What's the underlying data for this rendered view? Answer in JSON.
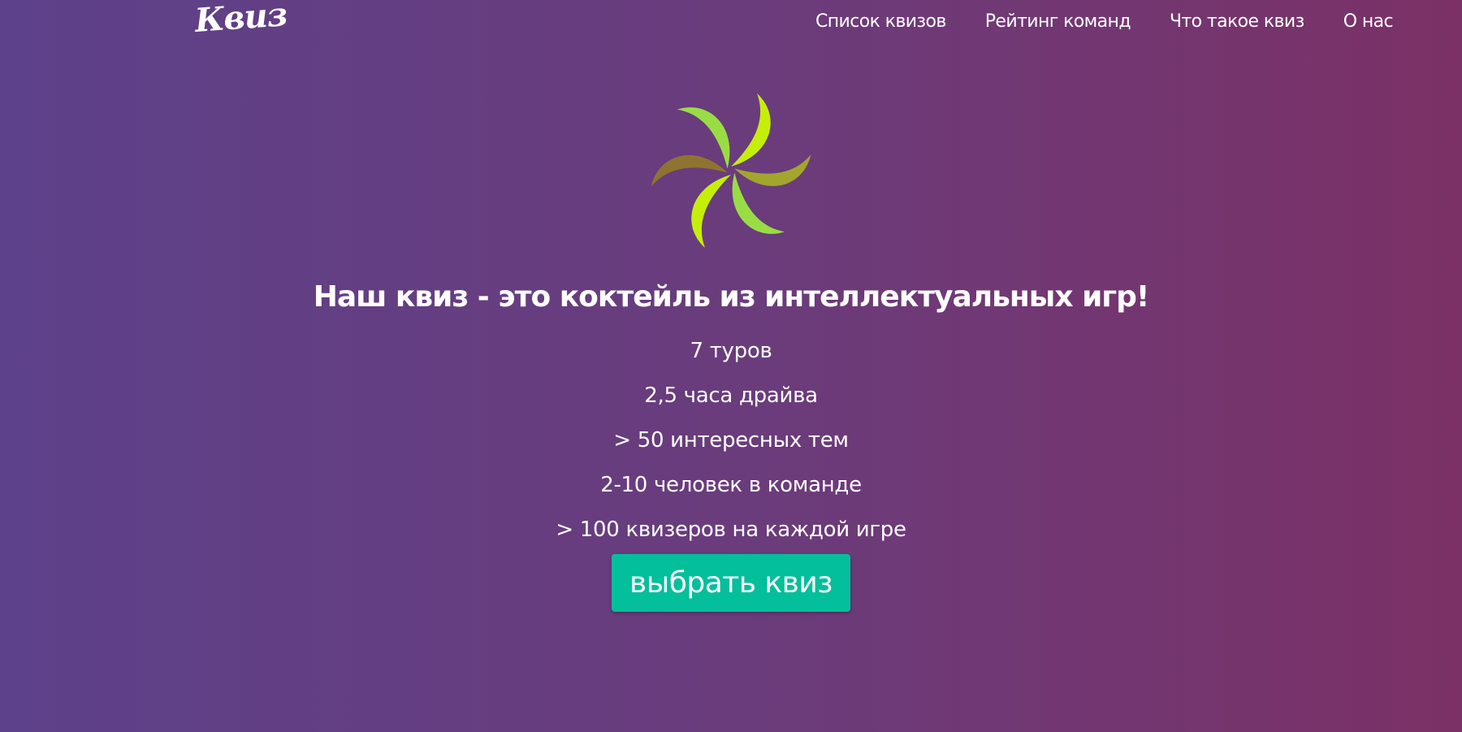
{
  "header": {
    "logo_text": "Квиз",
    "nav": [
      {
        "label": "Список квизов"
      },
      {
        "label": "Рейтинг команд"
      },
      {
        "label": "Что такое квиз"
      },
      {
        "label": "О нас"
      }
    ]
  },
  "hero": {
    "emblem_icon": "spiral-petals-icon",
    "headline": "Наш квиз - это коктейль из интеллектуальных игр!",
    "features": [
      "7 туров",
      "2,5 часа драйва",
      "> 50 интересных тем",
      "2-10 человек в команде",
      "> 100 квизеров на каждой игре"
    ],
    "cta_label": "выбрать квиз"
  },
  "colors": {
    "background_start": "#5d418a",
    "background_end": "#7b3166",
    "cta": "#03bf9b",
    "emblem_lime": "#c5ee0b",
    "emblem_green": "#99dd45",
    "emblem_olive": "#a2a62d",
    "emblem_brown": "#8e7430"
  }
}
